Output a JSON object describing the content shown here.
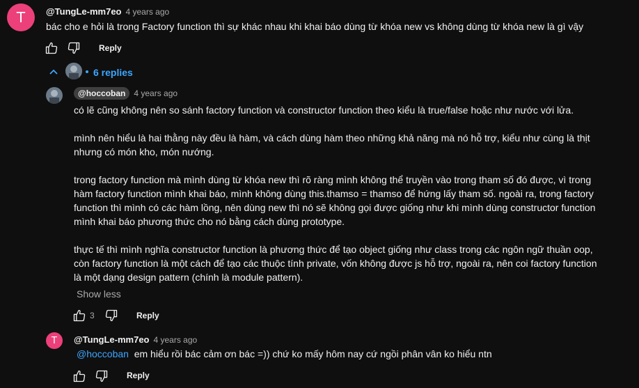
{
  "colors": {
    "background": "#0f0f0f",
    "avatar_pink": "#ec407a",
    "link_blue": "#3ea6ff",
    "chip_bg": "#3f3f3f"
  },
  "comment1": {
    "avatar_letter": "T",
    "author": "@TungLe-mm7eo",
    "time": "4 years ago",
    "text": "bác cho e hỏi là trong Factory function thì sự khác nhau khi khai báo dùng từ khóa new vs không dùng từ khóa new là gì vậy",
    "reply_label": "Reply"
  },
  "replies_toggle": {
    "label": "6 replies"
  },
  "reply1": {
    "author": "@hoccoban",
    "time": "4 years ago",
    "lines": [
      "có lẽ cũng không nên so sánh factory function và constructor function theo kiểu là true/false hoặc như nước với lửa.",
      "",
      "mình nên hiểu là hai thằng này đều là hàm, và cách dùng hàm theo những khả năng mà nó hỗ trợ, kiểu như cùng là thịt",
      "nhưng có món kho, món nướng.",
      "",
      "trong factory function mà mình dùng từ khóa new thì rõ ràng mình không thể truyền vào trong tham số đó được, vì trong",
      "hàm factory function mình khai báo, mình không dùng this.thamso = thamso để hứng lấy tham số. ngoài ra, trong factory",
      "function thì mình có các hàm lồng, nên dùng new thì nó sẽ không gọi được giống như khi mình dùng constructor function",
      "mình khai báo phương thức cho nó bằng cách dùng prototype.",
      "",
      "thực tế thì mình nghĩa constructor function là phương thức để tạo object giống như class trong các ngôn ngữ thuần oop,",
      "còn factory function là một cách để tạo các thuộc tính private, vốn không được js hỗ trợ, ngoài ra, nên coi factory function",
      "là một dạng design pattern (chính là module pattern)."
    ],
    "show_less": "Show less",
    "like_count": "3",
    "reply_label": "Reply"
  },
  "reply2": {
    "avatar_letter": "T",
    "author": "@TungLe-mm7eo",
    "time": "4 years ago",
    "mention": "@hoccoban",
    "text": "em hiểu rồi bác cảm ơn bác =)) chứ ko mấy hôm nay cứ ngồi phân vân ko hiểu ntn",
    "reply_label": "Reply"
  }
}
